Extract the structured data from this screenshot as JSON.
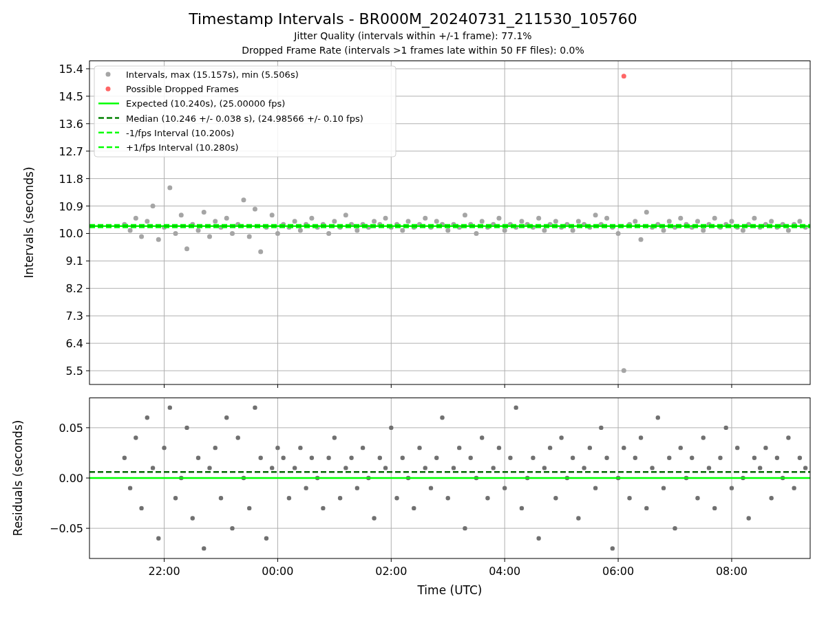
{
  "figure": {
    "title": "Timestamp Intervals - BR000M_20240731_211530_105760",
    "subtitles": [
      "Jitter Quality (intervals within +/-1 frame): 77.1%",
      "Dropped Frame Rate (intervals >1 frames late within 50 FF files): 0.0%"
    ]
  },
  "top_plot": {
    "chart_data": {
      "type": "scatter",
      "ylabel": "Intervals (seconds)",
      "grid": true,
      "legend": "upper left",
      "xlim": [
        "2024-07-31T20:41",
        "2024-08-01T09:23"
      ],
      "ylim": [
        5.05,
        15.67
      ],
      "yticks": [
        {
          "value": 5.5,
          "label": "5.5"
        },
        {
          "value": 6.4,
          "label": "6.4"
        },
        {
          "value": 7.3,
          "label": "7.3"
        },
        {
          "value": 8.2,
          "label": "8.2"
        },
        {
          "value": 9.1,
          "label": "9.1"
        },
        {
          "value": 10,
          "label": "10.0"
        },
        {
          "value": 10.9,
          "label": "10.9"
        },
        {
          "value": 11.8,
          "label": "11.8"
        },
        {
          "value": 12.7,
          "label": "12.7"
        },
        {
          "value": 13.6,
          "label": "13.6"
        },
        {
          "value": 14.5,
          "label": "14.5"
        },
        {
          "value": 15.4,
          "label": "15.4"
        }
      ],
      "x": [
        "2024-07-31T21:18",
        "2024-07-31T21:24",
        "2024-07-31T21:30",
        "2024-07-31T21:36",
        "2024-07-31T21:42",
        "2024-07-31T21:48",
        "2024-07-31T21:54",
        "2024-07-31T22:00",
        "2024-07-31T22:06",
        "2024-07-31T22:12",
        "2024-07-31T22:18",
        "2024-07-31T22:24",
        "2024-07-31T22:30",
        "2024-07-31T22:36",
        "2024-07-31T22:42",
        "2024-07-31T22:48",
        "2024-07-31T22:54",
        "2024-07-31T23:00",
        "2024-07-31T23:06",
        "2024-07-31T23:12",
        "2024-07-31T23:18",
        "2024-07-31T23:24",
        "2024-07-31T23:30",
        "2024-07-31T23:36",
        "2024-07-31T23:42",
        "2024-07-31T23:48",
        "2024-07-31T23:54",
        "2024-08-01T00:00",
        "2024-08-01T00:06",
        "2024-08-01T00:12",
        "2024-08-01T00:18",
        "2024-08-01T00:24",
        "2024-08-01T00:30",
        "2024-08-01T00:36",
        "2024-08-01T00:42",
        "2024-08-01T00:48",
        "2024-08-01T00:54",
        "2024-08-01T01:00",
        "2024-08-01T01:06",
        "2024-08-01T01:12",
        "2024-08-01T01:18",
        "2024-08-01T01:24",
        "2024-08-01T01:30",
        "2024-08-01T01:36",
        "2024-08-01T01:42",
        "2024-08-01T01:48",
        "2024-08-01T01:54",
        "2024-08-01T02:00",
        "2024-08-01T02:06",
        "2024-08-01T02:12",
        "2024-08-01T02:18",
        "2024-08-01T02:24",
        "2024-08-01T02:30",
        "2024-08-01T02:36",
        "2024-08-01T02:42",
        "2024-08-01T02:48",
        "2024-08-01T02:54",
        "2024-08-01T03:00",
        "2024-08-01T03:06",
        "2024-08-01T03:12",
        "2024-08-01T03:18",
        "2024-08-01T03:24",
        "2024-08-01T03:30",
        "2024-08-01T03:36",
        "2024-08-01T03:42",
        "2024-08-01T03:48",
        "2024-08-01T03:54",
        "2024-08-01T04:00",
        "2024-08-01T04:06",
        "2024-08-01T04:12",
        "2024-08-01T04:18",
        "2024-08-01T04:24",
        "2024-08-01T04:30",
        "2024-08-01T04:36",
        "2024-08-01T04:42",
        "2024-08-01T04:48",
        "2024-08-01T04:54",
        "2024-08-01T05:00",
        "2024-08-01T05:06",
        "2024-08-01T05:12",
        "2024-08-01T05:18",
        "2024-08-01T05:24",
        "2024-08-01T05:30",
        "2024-08-01T05:36",
        "2024-08-01T05:42",
        "2024-08-01T05:48",
        "2024-08-01T05:54",
        "2024-08-01T06:00",
        "2024-08-01T06:06",
        "2024-08-01T06:12",
        "2024-08-01T06:18",
        "2024-08-01T06:24",
        "2024-08-01T06:30",
        "2024-08-01T06:36",
        "2024-08-01T06:42",
        "2024-08-01T06:48",
        "2024-08-01T06:54",
        "2024-08-01T07:00",
        "2024-08-01T07:06",
        "2024-08-01T07:12",
        "2024-08-01T07:18",
        "2024-08-01T07:24",
        "2024-08-01T07:30",
        "2024-08-01T07:36",
        "2024-08-01T07:42",
        "2024-08-01T07:48",
        "2024-08-01T07:54",
        "2024-08-01T08:00",
        "2024-08-01T08:06",
        "2024-08-01T08:12",
        "2024-08-01T08:18",
        "2024-08-01T08:24",
        "2024-08-01T08:30",
        "2024-08-01T08:36",
        "2024-08-01T08:42",
        "2024-08-01T08:48",
        "2024-08-01T08:54",
        "2024-08-01T09:00",
        "2024-08-01T09:06",
        "2024-08-01T09:12",
        "2024-08-01T09:18"
      ],
      "series": [
        {
          "name": "Intervals, max (15.157s), min (5.506s)",
          "color": "#a5a5a5",
          "values": [
            10.3,
            10.1,
            10.5,
            9.9,
            10.4,
            10.9,
            9.8,
            10.2,
            11.5,
            10.0,
            10.6,
            9.5,
            10.3,
            10.1,
            10.7,
            9.9,
            10.4,
            10.2,
            10.5,
            10.0,
            10.3,
            11.1,
            9.9,
            10.8,
            9.4,
            10.2,
            10.6,
            10.0,
            10.3,
            10.2,
            10.4,
            10.1,
            10.3,
            10.5,
            10.2,
            10.3,
            10.0,
            10.4,
            10.2,
            10.6,
            10.3,
            10.1,
            10.3,
            10.2,
            10.4,
            10.3,
            10.5,
            10.2,
            10.3,
            10.1,
            10.4,
            10.2,
            10.3,
            10.5,
            10.2,
            10.4,
            10.3,
            10.1,
            10.3,
            10.2,
            10.6,
            10.3,
            10.0,
            10.4,
            10.2,
            10.3,
            10.5,
            10.1,
            10.3,
            10.2,
            10.4,
            10.3,
            10.2,
            10.5,
            10.1,
            10.3,
            10.4,
            10.2,
            10.3,
            10.1,
            10.4,
            10.3,
            10.2,
            10.6,
            10.3,
            10.5,
            10.2,
            10.0,
            5.506,
            10.3,
            10.4,
            9.8,
            10.7,
            10.2,
            10.3,
            10.1,
            10.4,
            10.2,
            10.5,
            10.3,
            10.2,
            10.4,
            10.1,
            10.3,
            10.5,
            10.2,
            10.3,
            10.4,
            10.2,
            10.1,
            10.3,
            10.5,
            10.2,
            10.3,
            10.4,
            10.2,
            10.3,
            10.1,
            10.3,
            10.4,
            10.2
          ]
        },
        {
          "name": "Possible Dropped Frames",
          "color": "#ff6666",
          "x": [
            "2024-08-01T06:06"
          ],
          "values": [
            15.157
          ]
        }
      ],
      "ref_lines": [
        {
          "axis": "y",
          "value": 10.24,
          "color": "#00ff00",
          "label": "Expected (10.240s), (25.00000 fps)"
        },
        {
          "axis": "y",
          "value": 10.246,
          "color": "#008000",
          "label": "Median (10.246 +/- 0.038 s), (24.98566 +/- 0.10 fps)"
        },
        {
          "axis": "y",
          "value": 10.2,
          "color": "#00ff00",
          "label": "-1/fps Interval (10.200s)"
        },
        {
          "axis": "y",
          "value": 10.28,
          "color": "#00ff00",
          "label": "+1/fps Interval (10.280s)"
        }
      ]
    }
  },
  "bottom_plot": {
    "chart_data": {
      "type": "scatter",
      "xlabel": "Time (UTC)",
      "ylabel": "Residuals (seconds)",
      "grid": true,
      "xlim": [
        "2024-07-31T20:41",
        "2024-08-01T09:23"
      ],
      "ylim": [
        -0.08,
        0.08
      ],
      "xticks": [
        {
          "value": "2024-07-31T22:00",
          "label": "22:00"
        },
        {
          "value": "2024-08-01T00:00",
          "label": "00:00"
        },
        {
          "value": "2024-08-01T02:00",
          "label": "02:00"
        },
        {
          "value": "2024-08-01T04:00",
          "label": "04:00"
        },
        {
          "value": "2024-08-01T06:00",
          "label": "06:00"
        },
        {
          "value": "2024-08-01T08:00",
          "label": "08:00"
        }
      ],
      "yticks": [
        {
          "value": -0.05,
          "label": "−0.05"
        },
        {
          "value": 0,
          "label": "0.00"
        },
        {
          "value": 0.05,
          "label": "0.05"
        }
      ],
      "x": [
        "2024-07-31T21:18",
        "2024-07-31T21:24",
        "2024-07-31T21:30",
        "2024-07-31T21:36",
        "2024-07-31T21:42",
        "2024-07-31T21:48",
        "2024-07-31T21:54",
        "2024-07-31T22:00",
        "2024-07-31T22:06",
        "2024-07-31T22:12",
        "2024-07-31T22:18",
        "2024-07-31T22:24",
        "2024-07-31T22:30",
        "2024-07-31T22:36",
        "2024-07-31T22:42",
        "2024-07-31T22:48",
        "2024-07-31T22:54",
        "2024-07-31T23:00",
        "2024-07-31T23:06",
        "2024-07-31T23:12",
        "2024-07-31T23:18",
        "2024-07-31T23:24",
        "2024-07-31T23:30",
        "2024-07-31T23:36",
        "2024-07-31T23:42",
        "2024-07-31T23:48",
        "2024-07-31T23:54",
        "2024-08-01T00:00",
        "2024-08-01T00:06",
        "2024-08-01T00:12",
        "2024-08-01T00:18",
        "2024-08-01T00:24",
        "2024-08-01T00:30",
        "2024-08-01T00:36",
        "2024-08-01T00:42",
        "2024-08-01T00:48",
        "2024-08-01T00:54",
        "2024-08-01T01:00",
        "2024-08-01T01:06",
        "2024-08-01T01:12",
        "2024-08-01T01:18",
        "2024-08-01T01:24",
        "2024-08-01T01:30",
        "2024-08-01T01:36",
        "2024-08-01T01:42",
        "2024-08-01T01:48",
        "2024-08-01T01:54",
        "2024-08-01T02:00",
        "2024-08-01T02:06",
        "2024-08-01T02:12",
        "2024-08-01T02:18",
        "2024-08-01T02:24",
        "2024-08-01T02:30",
        "2024-08-01T02:36",
        "2024-08-01T02:42",
        "2024-08-01T02:48",
        "2024-08-01T02:54",
        "2024-08-01T03:00",
        "2024-08-01T03:06",
        "2024-08-01T03:12",
        "2024-08-01T03:18",
        "2024-08-01T03:24",
        "2024-08-01T03:30",
        "2024-08-01T03:36",
        "2024-08-01T03:42",
        "2024-08-01T03:48",
        "2024-08-01T03:54",
        "2024-08-01T04:00",
        "2024-08-01T04:06",
        "2024-08-01T04:12",
        "2024-08-01T04:18",
        "2024-08-01T04:24",
        "2024-08-01T04:30",
        "2024-08-01T04:36",
        "2024-08-01T04:42",
        "2024-08-01T04:48",
        "2024-08-01T04:54",
        "2024-08-01T05:00",
        "2024-08-01T05:06",
        "2024-08-01T05:12",
        "2024-08-01T05:18",
        "2024-08-01T05:24",
        "2024-08-01T05:30",
        "2024-08-01T05:36",
        "2024-08-01T05:42",
        "2024-08-01T05:48",
        "2024-08-01T05:54",
        "2024-08-01T06:00",
        "2024-08-01T06:06",
        "2024-08-01T06:12",
        "2024-08-01T06:18",
        "2024-08-01T06:24",
        "2024-08-01T06:30",
        "2024-08-01T06:36",
        "2024-08-01T06:42",
        "2024-08-01T06:48",
        "2024-08-01T06:54",
        "2024-08-01T07:00",
        "2024-08-01T07:06",
        "2024-08-01T07:12",
        "2024-08-01T07:18",
        "2024-08-01T07:24",
        "2024-08-01T07:30",
        "2024-08-01T07:36",
        "2024-08-01T07:42",
        "2024-08-01T07:48",
        "2024-08-01T07:54",
        "2024-08-01T08:00",
        "2024-08-01T08:06",
        "2024-08-01T08:12",
        "2024-08-01T08:18",
        "2024-08-01T08:24",
        "2024-08-01T08:30",
        "2024-08-01T08:36",
        "2024-08-01T08:42",
        "2024-08-01T08:48",
        "2024-08-01T08:54",
        "2024-08-01T09:00",
        "2024-08-01T09:06",
        "2024-08-01T09:12",
        "2024-08-01T09:18"
      ],
      "series": [
        {
          "color": "#707070",
          "values": [
            0.02,
            -0.01,
            0.04,
            -0.03,
            0.06,
            0.01,
            -0.06,
            0.03,
            0.07,
            -0.02,
            0.0,
            0.05,
            -0.04,
            0.02,
            -0.07,
            0.01,
            0.03,
            -0.02,
            0.06,
            -0.05,
            0.04,
            0.0,
            -0.03,
            0.07,
            0.02,
            -0.06,
            0.01,
            0.03,
            0.02,
            -0.02,
            0.01,
            0.03,
            -0.01,
            0.02,
            0.0,
            -0.03,
            0.02,
            0.04,
            -0.02,
            0.01,
            0.02,
            -0.01,
            0.03,
            0.0,
            -0.04,
            0.02,
            0.01,
            0.05,
            -0.02,
            0.02,
            0.0,
            -0.03,
            0.03,
            0.01,
            -0.01,
            0.02,
            0.06,
            -0.02,
            0.01,
            0.03,
            -0.05,
            0.02,
            0.0,
            0.04,
            -0.02,
            0.01,
            0.03,
            -0.01,
            0.02,
            0.07,
            -0.03,
            0.0,
            0.02,
            -0.06,
            0.01,
            0.03,
            -0.02,
            0.04,
            0.0,
            0.02,
            -0.04,
            0.01,
            0.03,
            -0.01,
            0.05,
            0.02,
            -0.07,
            0.0,
            0.03,
            -0.02,
            0.02,
            0.04,
            -0.03,
            0.01,
            0.06,
            -0.01,
            0.02,
            -0.05,
            0.03,
            0.0,
            0.02,
            -0.02,
            0.04,
            0.01,
            -0.03,
            0.02,
            0.05,
            -0.01,
            0.03,
            0.0,
            -0.04,
            0.02,
            0.01,
            0.03,
            -0.02,
            0.02,
            0.0,
            0.04,
            -0.01,
            0.02,
            0.01
          ]
        }
      ],
      "ref_lines": [
        {
          "axis": "y",
          "value": 0,
          "color": "#00ff00"
        },
        {
          "axis": "y",
          "value": 0.006,
          "color": "#006400"
        }
      ]
    }
  }
}
